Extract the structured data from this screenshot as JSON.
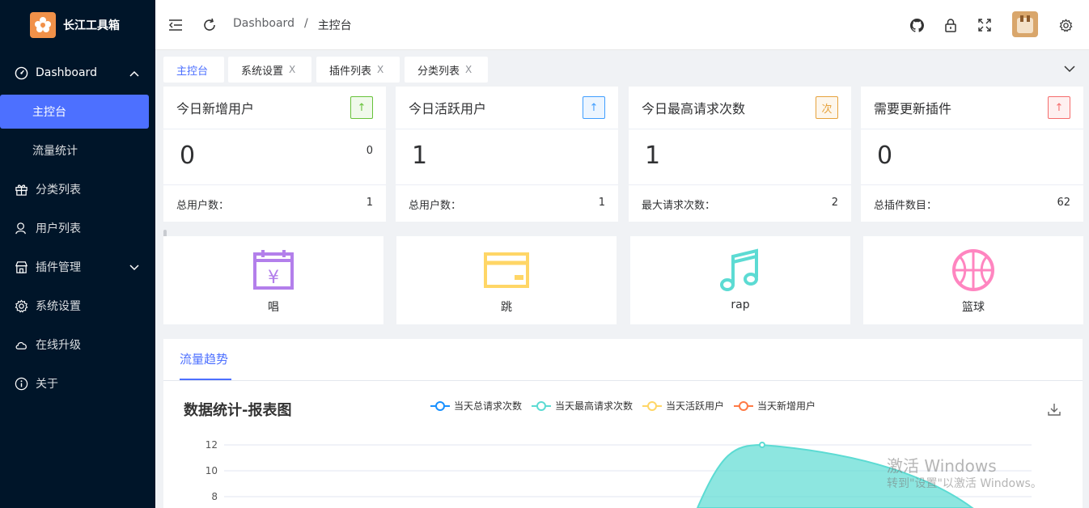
{
  "app": {
    "name": "长江工具箱"
  },
  "sidebar": {
    "items": [
      {
        "label": "Dashboard",
        "icon": "dashboard-icon"
      },
      {
        "label": "主控台"
      },
      {
        "label": "流量统计"
      },
      {
        "label": "分类列表",
        "icon": "gift-icon"
      },
      {
        "label": "用户列表",
        "icon": "user-icon"
      },
      {
        "label": "插件管理",
        "icon": "shop-icon"
      },
      {
        "label": "系统设置",
        "icon": "gear-icon"
      },
      {
        "label": "在线升级",
        "icon": "cloud-icon"
      },
      {
        "label": "关于",
        "icon": "info-icon"
      }
    ]
  },
  "header": {
    "breadcrumb": [
      "Dashboard",
      "/",
      "主控台"
    ]
  },
  "tabs": [
    {
      "label": "主控台",
      "active": true
    },
    {
      "label": "系统设置",
      "close": "X"
    },
    {
      "label": "插件列表",
      "close": "X"
    },
    {
      "label": "分类列表",
      "close": "X"
    }
  ],
  "cards": [
    {
      "title": "今日新增用户",
      "badge": "↑",
      "badge_color": "#67c23a",
      "badge_bg": "#f0f9eb",
      "value": "0",
      "small": "0",
      "foot_label": "总用户数：",
      "foot_value": "1"
    },
    {
      "title": "今日活跃用户",
      "badge": "↑",
      "badge_color": "#409eff",
      "badge_bg": "#ecf5ff",
      "value": "1",
      "small": "",
      "foot_label": "总用户数：",
      "foot_value": "1"
    },
    {
      "title": "今日最高请求次数",
      "badge": "次",
      "badge_color": "#e6a23c",
      "badge_bg": "#fdf6ec",
      "value": "1",
      "small": "",
      "foot_label": "最大请求次数：",
      "foot_value": "2"
    },
    {
      "title": "需要更新插件",
      "badge": "↑",
      "badge_color": "#f56c6c",
      "badge_bg": "#fef0f0",
      "value": "0",
      "small": "",
      "foot_label": "总插件数目：",
      "foot_value": "62"
    }
  ],
  "quick": [
    {
      "label": "唱",
      "icon": "calendar-yen-icon",
      "color": "#b37feb"
    },
    {
      "label": "跳",
      "icon": "wallet-icon",
      "color": "#ffd666"
    },
    {
      "label": "rap",
      "icon": "music-icon",
      "color": "#5cdbd3"
    },
    {
      "label": "篮球",
      "icon": "basketball-icon",
      "color": "#ff85c0"
    }
  ],
  "panel": {
    "tab": "流量趋势",
    "title": "数据统计-报表图",
    "legend": [
      {
        "name": "当天总请求次数",
        "color": "#1890ff"
      },
      {
        "name": "当天最高请求次数",
        "color": "#5cdbd3"
      },
      {
        "name": "当天活跃用户",
        "color": "#ffd666"
      },
      {
        "name": "当天新增用户",
        "color": "#ff7a45"
      }
    ]
  },
  "watermark": {
    "line1": "激活 Windows",
    "line2": "转到\"设置\"以激活 Windows。"
  },
  "chart_data": {
    "type": "area",
    "series": [
      {
        "name": "当天最高请求次数",
        "values": [
          12
        ]
      }
    ],
    "y_ticks": [
      12,
      10,
      8
    ]
  }
}
